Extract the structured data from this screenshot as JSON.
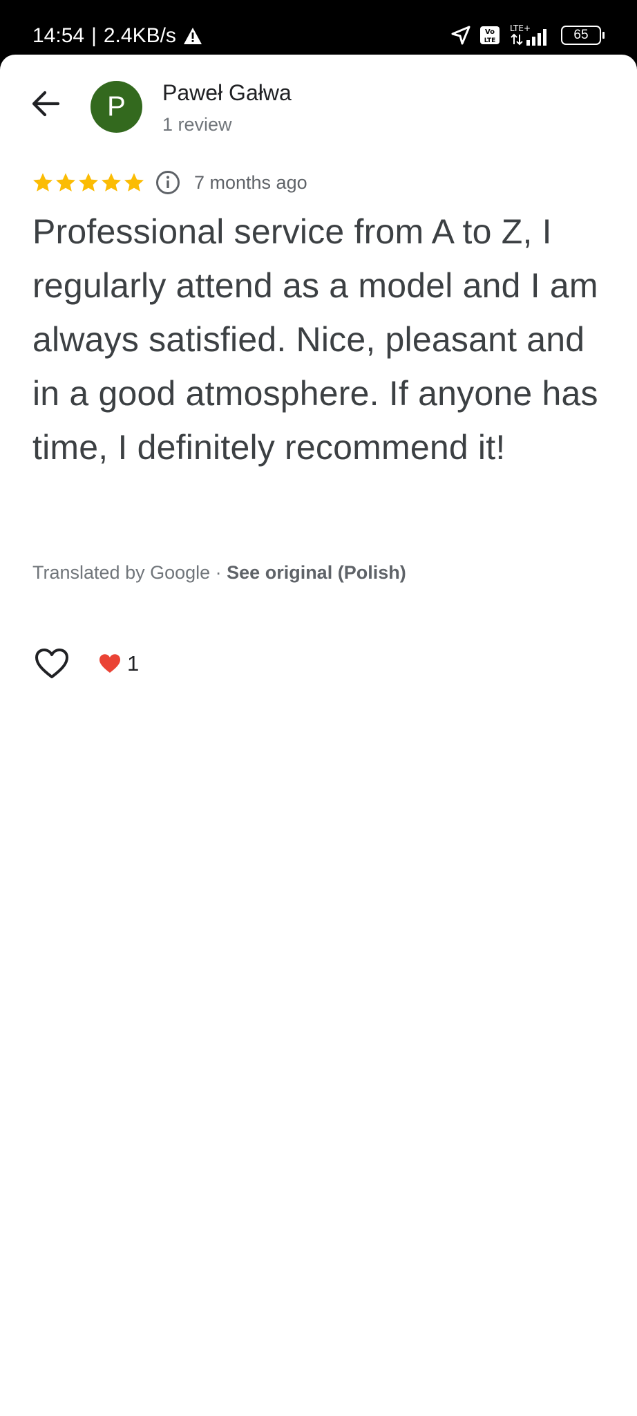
{
  "status_bar": {
    "time": "14:54",
    "separator": "|",
    "network_speed": "2.4KB/s",
    "warning_icon": "warning-triangle-icon",
    "network_label": "LTE+",
    "volte_label": "Vo LTE",
    "battery": "65"
  },
  "review": {
    "author_name": "Paweł Gałwa",
    "author_initial": "P",
    "author_meta": "1 review",
    "rating": 5,
    "rating_max": 5,
    "date": "7 months ago",
    "text": "Professional service from A to Z, I regularly attend as a model and I am always satisfied. Nice, pleasant and in a good atmosphere. If anyone has time, I definitely recommend it!",
    "translated_by": "Translated by Google",
    "dot": " · ",
    "see_original": "See original (Polish)",
    "reaction_count": "1"
  },
  "colors": {
    "avatar": "#33691e",
    "star": "#fbbc04",
    "heart": "#ea4335"
  }
}
